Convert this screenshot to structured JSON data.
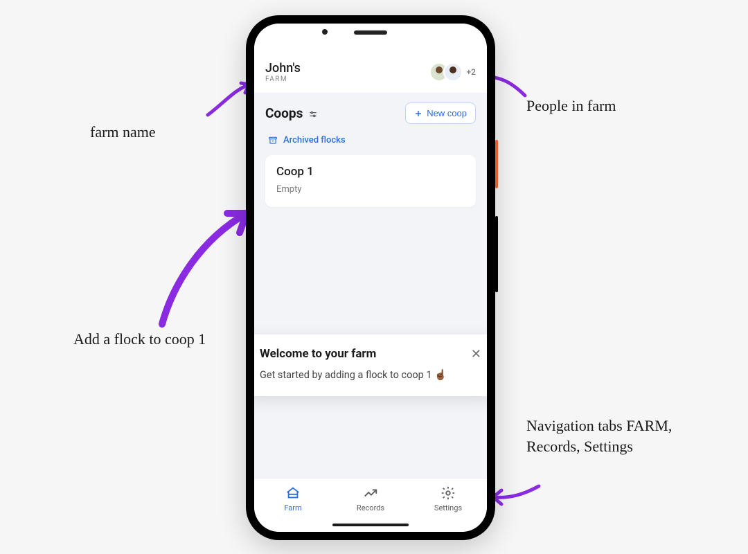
{
  "header": {
    "farm_name": "John's",
    "farm_sub": "FARM",
    "plus_count": "+2"
  },
  "section": {
    "title": "Coops",
    "new_btn": "New coop",
    "archived": "Archived flocks"
  },
  "coops": [
    {
      "name": "Coop 1",
      "status": "Empty"
    }
  ],
  "welcome": {
    "title": "Welcome to your farm",
    "body": "Get started by adding a flock to coop 1 ☝🏾"
  },
  "tabs": {
    "farm": "Farm",
    "records": "Records",
    "settings": "Settings"
  },
  "annotations": {
    "farm_name": "farm name",
    "people": "People in farm",
    "add_flock": "Add a flock to coop 1",
    "tabs": "Navigation tabs FARM, Records, Settings"
  }
}
